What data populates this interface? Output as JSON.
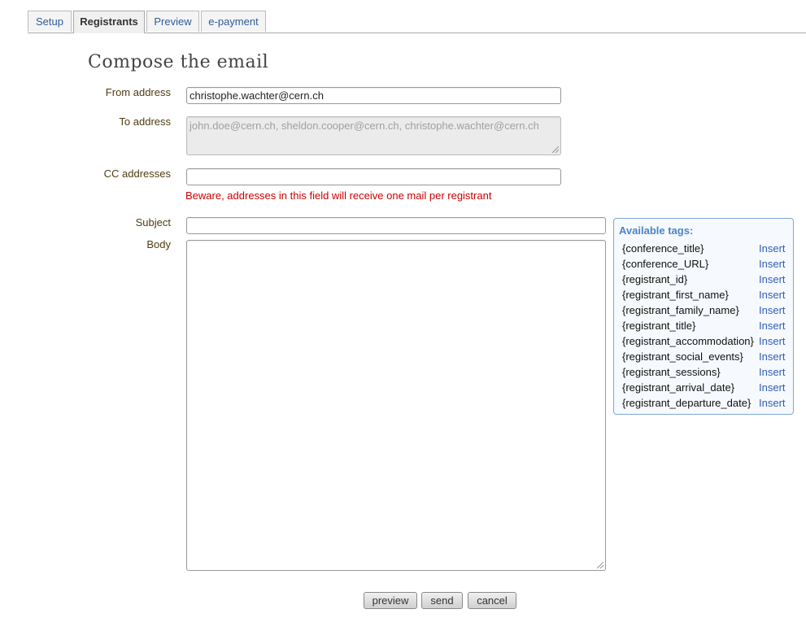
{
  "tabs": [
    {
      "label": "Setup"
    },
    {
      "label": "Registrants"
    },
    {
      "label": "Preview"
    },
    {
      "label": "e-payment"
    }
  ],
  "active_tab": "Registrants",
  "page_title": "Compose the email",
  "form": {
    "from_label": "From address",
    "from_value": "christophe.wachter@cern.ch",
    "to_label": "To address",
    "to_value": "john.doe@cern.ch, sheldon.cooper@cern.ch, christophe.wachter@cern.ch",
    "cc_label": "CC addresses",
    "cc_value": "",
    "cc_warning": "Beware, addresses in this field will receive one mail per registrant",
    "subject_label": "Subject",
    "subject_value": "",
    "body_label": "Body",
    "body_value": ""
  },
  "tags_panel": {
    "title": "Available tags:",
    "insert_label": "Insert",
    "items": [
      {
        "tag": "{conference_title}"
      },
      {
        "tag": "{conference_URL}"
      },
      {
        "tag": "{registrant_id}"
      },
      {
        "tag": "{registrant_first_name}"
      },
      {
        "tag": "{registrant_family_name}"
      },
      {
        "tag": "{registrant_title}"
      },
      {
        "tag": "{registrant_accommodation}"
      },
      {
        "tag": "{registrant_social_events}"
      },
      {
        "tag": "{registrant_sessions}"
      },
      {
        "tag": "{registrant_arrival_date}"
      },
      {
        "tag": "{registrant_departure_date}"
      }
    ]
  },
  "buttons": {
    "preview": "preview",
    "send": "send",
    "cancel": "cancel"
  },
  "colors": {
    "warning": "#cc0000",
    "link": "#2f5fb8",
    "tags_title": "#4a86c5",
    "label": "#4f3c10"
  }
}
